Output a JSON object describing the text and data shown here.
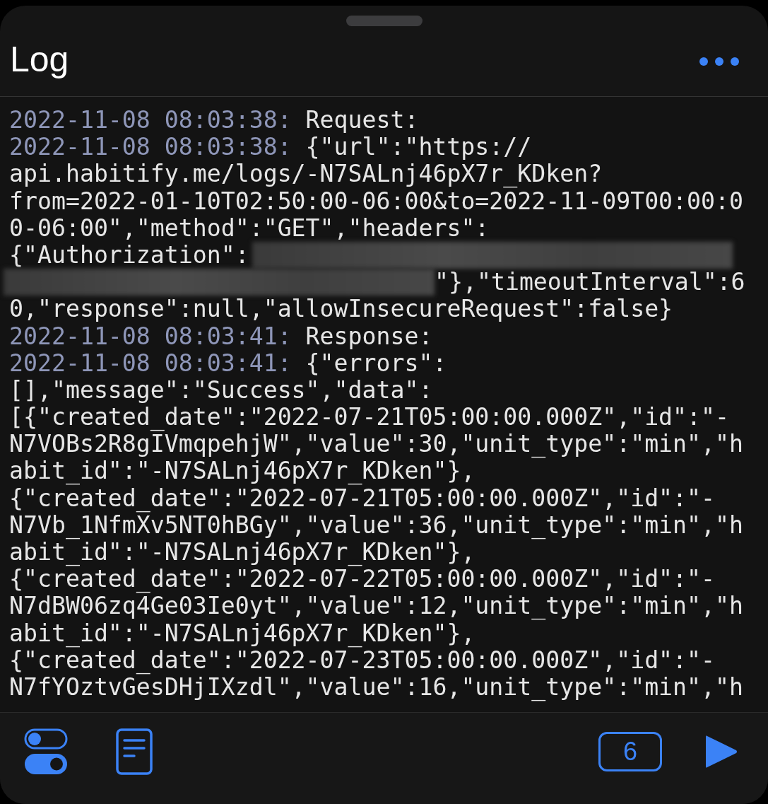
{
  "title": "Log",
  "lines": [
    {
      "kind": "entry",
      "timestamp": "2022-11-08 08:03:38:",
      "text": "Request:"
    },
    {
      "kind": "entry",
      "timestamp": "2022-11-08 08:03:38:",
      "text": "{\"url\":\"https://"
    },
    {
      "kind": "text",
      "text": "api.habitify.me/logs/-N7SALnj46pX7r_KDken?"
    },
    {
      "kind": "text",
      "text": "from=2022-01-10T02:50:00-06:00&to=2022-11-09T00:00:0"
    },
    {
      "kind": "text",
      "text": "0-06:00\",\"method\":\"GET\",\"headers\":"
    },
    {
      "kind": "redacted_after",
      "text": "{\"Authorization\":"
    },
    {
      "kind": "redacted_before",
      "text": "\"},\"timeoutInterval\":6"
    },
    {
      "kind": "text",
      "text": "0,\"response\":null,\"allowInsecureRequest\":false}"
    },
    {
      "kind": "entry",
      "timestamp": "2022-11-08 08:03:41:",
      "text": "Response:"
    },
    {
      "kind": "entry",
      "timestamp": "2022-11-08 08:03:41:",
      "text": "{\"errors\":"
    },
    {
      "kind": "text",
      "text": "[],\"message\":\"Success\",\"data\":"
    },
    {
      "kind": "text",
      "text": "[{\"created_date\":\"2022-07-21T05:00:00.000Z\",\"id\":\"-"
    },
    {
      "kind": "text",
      "text": "N7VOBs2R8gIVmqpehjW\",\"value\":30,\"unit_type\":\"min\",\"h"
    },
    {
      "kind": "text",
      "text": "abit_id\":\"-N7SALnj46pX7r_KDken\"},"
    },
    {
      "kind": "text",
      "text": "{\"created_date\":\"2022-07-21T05:00:00.000Z\",\"id\":\"-"
    },
    {
      "kind": "text",
      "text": "N7Vb_1NfmXv5NT0hBGy\",\"value\":36,\"unit_type\":\"min\",\"h"
    },
    {
      "kind": "text",
      "text": "abit_id\":\"-N7SALnj46pX7r_KDken\"},"
    },
    {
      "kind": "text",
      "text": "{\"created_date\":\"2022-07-22T05:00:00.000Z\",\"id\":\"-"
    },
    {
      "kind": "text",
      "text": "N7dBW06zq4Ge03Ie0yt\",\"value\":12,\"unit_type\":\"min\",\"h"
    },
    {
      "kind": "text",
      "text": "abit_id\":\"-N7SALnj46pX7r_KDken\"},"
    },
    {
      "kind": "text",
      "text": "{\"created_date\":\"2022-07-23T05:00:00.000Z\",\"id\":\"-"
    },
    {
      "kind": "text",
      "text": "N7fYOztvGesDHjIXzdl\",\"value\":16,\"unit_type\":\"min\",\"h"
    }
  ],
  "count": "6"
}
